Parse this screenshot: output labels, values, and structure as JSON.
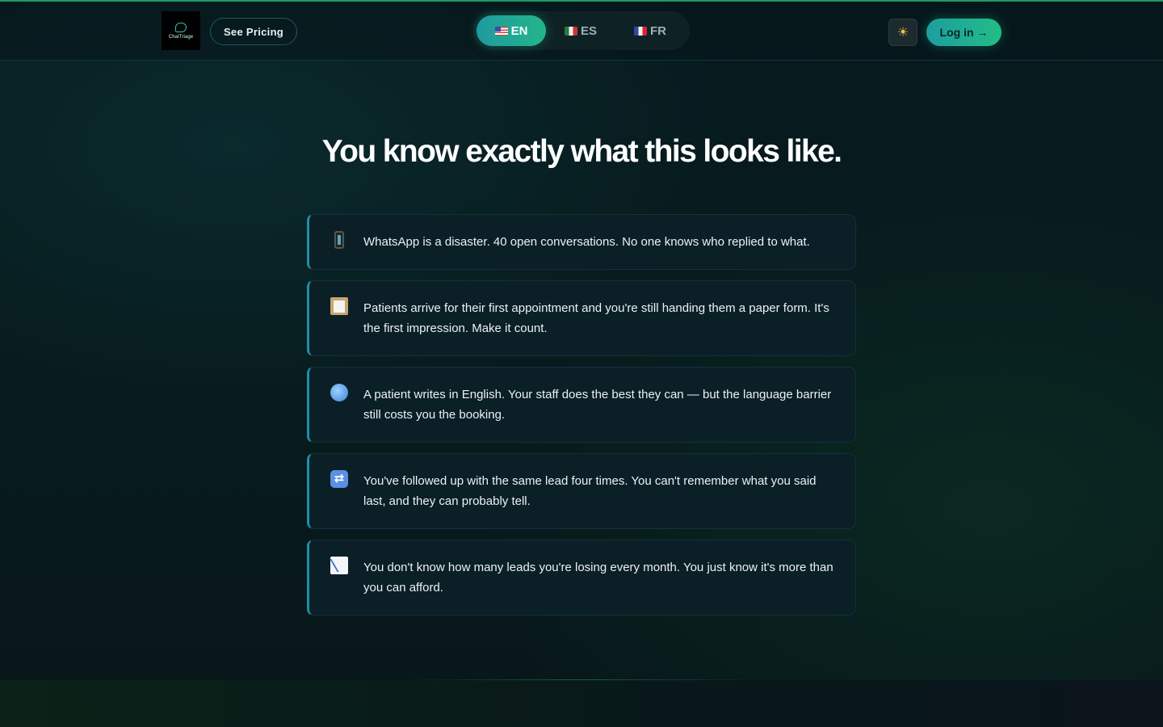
{
  "header": {
    "logo_text": "ChatTriage",
    "pricing_label": "See Pricing",
    "languages": [
      {
        "code": "EN",
        "active": true
      },
      {
        "code": "ES",
        "active": false
      },
      {
        "code": "FR",
        "active": false
      }
    ],
    "theme_icon": "sun-icon",
    "login_label": "Log in →"
  },
  "main": {
    "title": "You know exactly what this looks like.",
    "cards": [
      {
        "icon": "mobile-phone-icon",
        "text": "WhatsApp is a disaster. 40 open conversations. No one knows who replied to what."
      },
      {
        "icon": "clipboard-icon",
        "text": "Patients arrive for their first appointment and you're still handing them a paper form. It's the first impression. Make it count."
      },
      {
        "icon": "globe-icon",
        "text": "A patient writes in English. Your staff does the best they can — but the language barrier still costs you the booking."
      },
      {
        "icon": "repeat-icon",
        "text": "You've followed up with the same lead four times. You can't remember what you said last, and they can probably tell."
      },
      {
        "icon": "chart-decreasing-icon",
        "text": "You don't know how many leads you're losing every month. You just know it's more than you can afford."
      }
    ]
  },
  "colors": {
    "accent_teal": "#1d8fa6",
    "accent_green": "#23bd86",
    "background": "#07161a"
  }
}
